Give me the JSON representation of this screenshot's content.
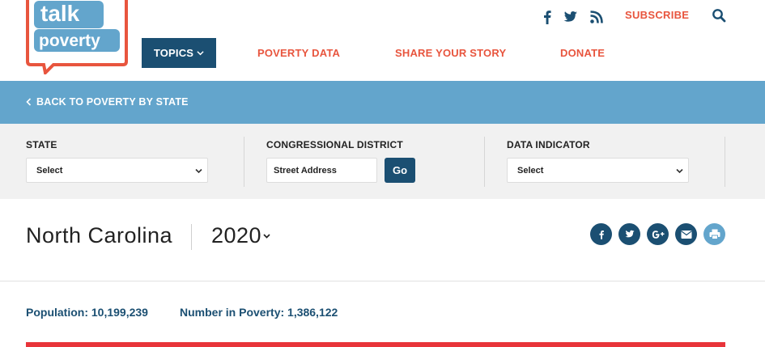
{
  "header": {
    "logo_text": [
      "talk",
      "poverty"
    ],
    "nav": {
      "topics_label": "TOPICS",
      "links": [
        "POVERTY DATA",
        "SHARE YOUR STORY",
        "DONATE"
      ]
    },
    "social_icons": [
      "facebook-icon",
      "twitter-icon",
      "rss-icon"
    ],
    "subscribe_label": "SUBSCRIBE",
    "search_icon": "search-icon"
  },
  "backbar": {
    "label": "BACK TO POVERTY BY STATE"
  },
  "filters": {
    "state": {
      "label": "STATE",
      "value": "Select"
    },
    "district": {
      "label": "CONGRESSIONAL DISTRICT",
      "placeholder": "Street Address",
      "go_label": "Go"
    },
    "indicator": {
      "label": "DATA INDICATOR",
      "value": "Select"
    }
  },
  "summary": {
    "state_name": "North Carolina",
    "year": "2020",
    "share_icons": [
      "facebook-icon",
      "twitter-icon",
      "google-plus-icon",
      "email-icon",
      "print-icon"
    ],
    "population": "Population: 10,199,239",
    "number_in_poverty": "Number in Poverty: 1,386,122"
  },
  "colors": {
    "navy": "#1b4f72",
    "coral": "#e8553e",
    "sky": "#63a5cc",
    "red": "#e8343a",
    "filter_bg": "#f1f1f1"
  }
}
